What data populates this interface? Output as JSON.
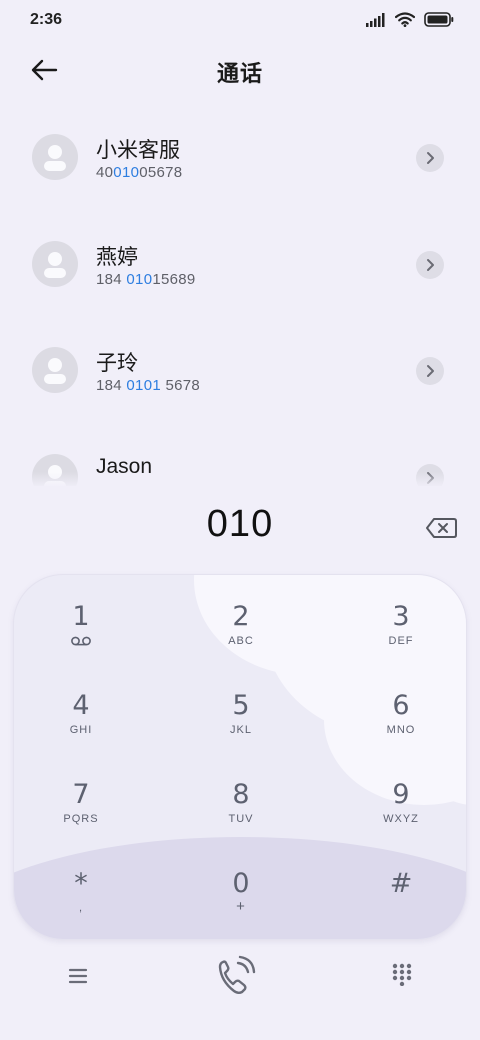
{
  "status": {
    "time": "2:36"
  },
  "header": {
    "title": "通话"
  },
  "contacts": [
    {
      "name": "小米客服",
      "number_pre": "40",
      "number_hl": "010",
      "number_post": "05678"
    },
    {
      "name": "燕婷",
      "number_pre": "184 ",
      "number_hl": "010",
      "number_post": "15689"
    },
    {
      "name": "子玲",
      "number_pre": "184 ",
      "number_hl": "0101",
      "number_post": " 5678"
    },
    {
      "name": "Jason",
      "number_pre": "",
      "number_hl": "",
      "number_post": ""
    }
  ],
  "dialer": {
    "input": "010"
  },
  "keypad": [
    {
      "digit": "1",
      "letters": ""
    },
    {
      "digit": "2",
      "letters": "ABC"
    },
    {
      "digit": "3",
      "letters": "DEF"
    },
    {
      "digit": "4",
      "letters": "GHI"
    },
    {
      "digit": "5",
      "letters": "JKL"
    },
    {
      "digit": "6",
      "letters": "MNO"
    },
    {
      "digit": "7",
      "letters": "PQRS"
    },
    {
      "digit": "8",
      "letters": "TUV"
    },
    {
      "digit": "9",
      "letters": "WXYZ"
    },
    {
      "digit": "*",
      "letters": ","
    },
    {
      "digit": "0",
      "letters": "+"
    },
    {
      "digit": "#",
      "letters": ""
    }
  ],
  "icons": {
    "signal": "signal-icon",
    "wifi": "wifi-icon",
    "battery": "battery-icon",
    "back": "back-arrow-icon",
    "detail": "chevron-right-icon",
    "delete": "backspace-icon",
    "voicemail": "voicemail-icon",
    "menu": "menu-icon",
    "call": "phone-call-icon",
    "grid": "dialpad-grid-icon"
  },
  "colors": {
    "background": "#f1eff9",
    "highlight": "#2e7ee0",
    "keypad": "#ecebf6",
    "key_text": "#5d6170"
  }
}
